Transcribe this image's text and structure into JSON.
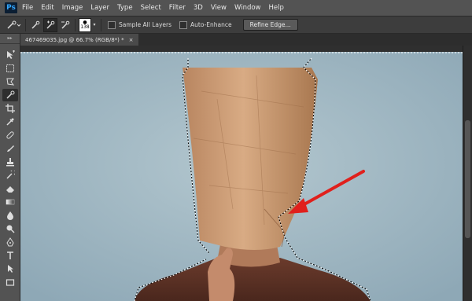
{
  "app": {
    "logo": "Ps"
  },
  "menu": [
    "File",
    "Edit",
    "Image",
    "Layer",
    "Type",
    "Select",
    "Filter",
    "3D",
    "View",
    "Window",
    "Help"
  ],
  "options": {
    "brush_size": "138",
    "sample_all_layers": "Sample All Layers",
    "auto_enhance": "Auto-Enhance",
    "refine_edge": "Refine Edge..."
  },
  "document": {
    "tab_title": "467469035.jpg @ 66.7% (RGB/8*) *",
    "close_glyph": "×"
  },
  "colors": {
    "wall": "#9eb6c2",
    "bag": "#c4966e",
    "sweater": "#5d3327",
    "arrow": "#e0201c",
    "menubar": "#535353"
  }
}
